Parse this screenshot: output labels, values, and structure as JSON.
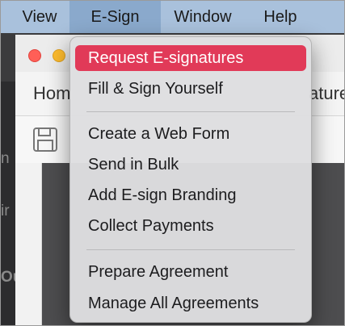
{
  "menubar": {
    "items": [
      {
        "label": "View"
      },
      {
        "label": "E-Sign"
      },
      {
        "label": "Window"
      },
      {
        "label": "Help"
      }
    ],
    "active_index": 1
  },
  "window": {
    "tab_label": "Hom",
    "tab_label_right": "ature",
    "side_labels": [
      "n",
      "ir",
      "Ou"
    ]
  },
  "dropdown": {
    "items": [
      {
        "label": "Request E-signatures",
        "highlighted": true
      },
      {
        "label": "Fill & Sign Yourself"
      },
      {
        "label": "Create a Web Form"
      },
      {
        "label": "Send in Bulk"
      },
      {
        "label": "Add E-sign Branding"
      },
      {
        "label": "Collect Payments"
      },
      {
        "label": "Prepare Agreement"
      },
      {
        "label": "Manage All Agreements"
      }
    ]
  },
  "colors": {
    "menubar": "#a9c1dc",
    "menubar_active": "#8aa9cc",
    "highlight": "#e13a58",
    "close": "#ff5f57",
    "minimize": "#febc2e"
  }
}
